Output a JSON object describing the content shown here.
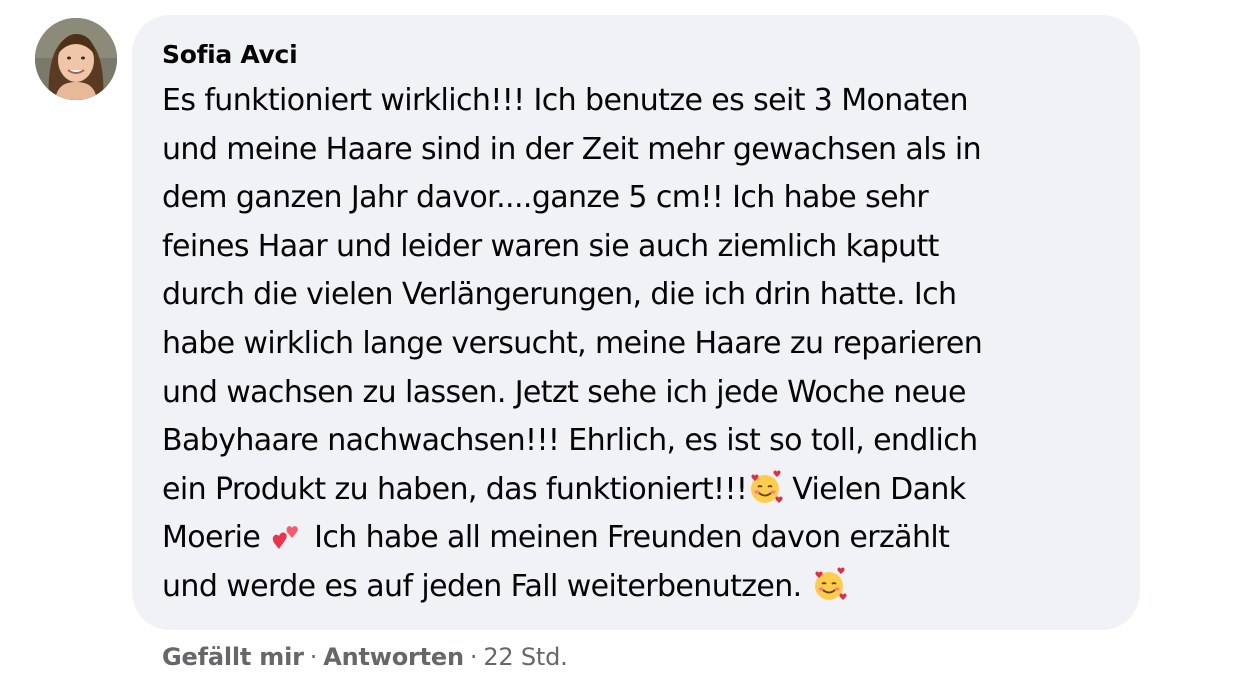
{
  "comment": {
    "author": "Sofia Avci",
    "lines": [
      "Es funktioniert wirklich!!! Ich benutze es seit 3 Monaten",
      "und meine Haare sind in der Zeit mehr gewachsen als in",
      "dem ganzen Jahr davor....ganze 5 cm!! Ich habe sehr",
      "feines Haar und leider waren sie auch ziemlich kaputt",
      "durch die vielen Verlängerungen, die ich drin hatte. Ich",
      "habe wirklich lange versucht, meine Haare zu reparieren",
      "und wachsen zu lassen. Jetzt sehe ich jede Woche neue",
      "Babyhaare nachwachsen!!! Ehrlich, es ist so toll, endlich",
      "ein Produkt zu haben, das funktioniert!!!",
      " Vielen Dank",
      "Moerie ",
      " Ich habe all meinen Freunden davon erzählt",
      "und werde es auf jeden Fall weiterbenutzen. "
    ],
    "emojis": {
      "smiling_hearts": "smiling-face-with-hearts-icon",
      "two_hearts": "two-hearts-icon"
    }
  },
  "actions": {
    "like": "Gefällt mir",
    "reply": "Antworten",
    "separator": "·",
    "time": "22 Std."
  },
  "colors": {
    "bubble_bg": "#f0f2f5",
    "text": "#050505",
    "secondary_text": "#65676b"
  }
}
